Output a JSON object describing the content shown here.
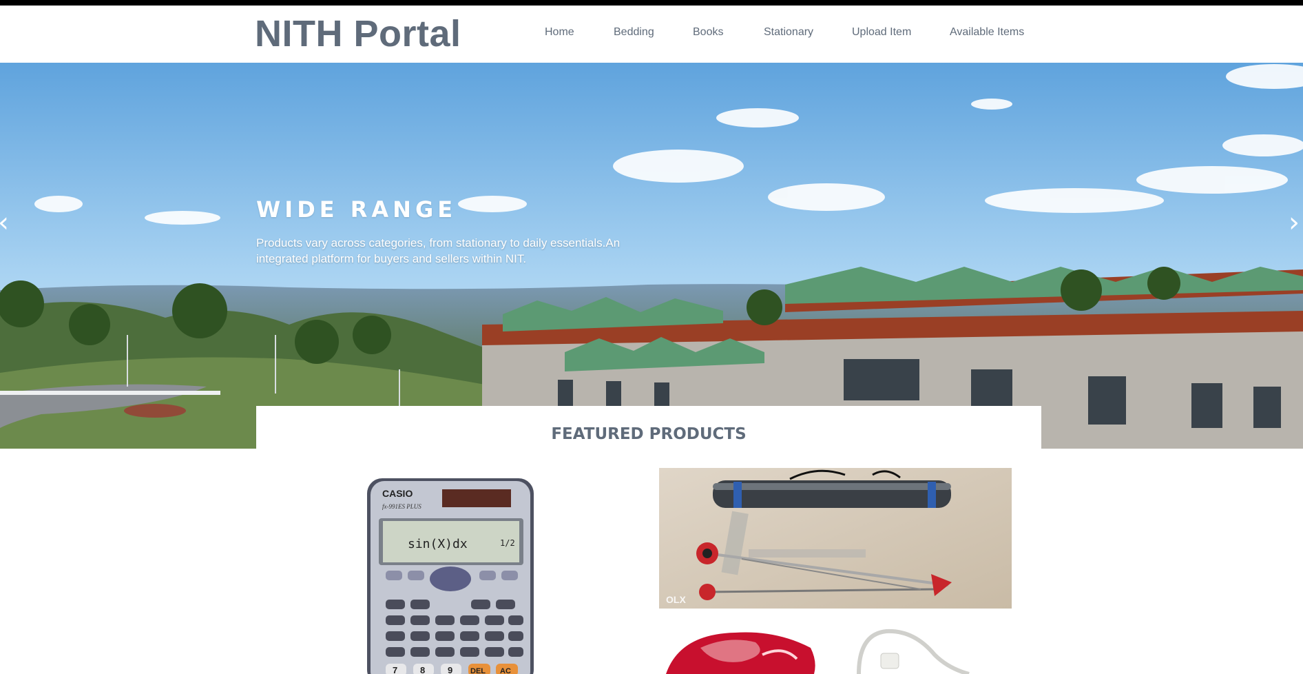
{
  "header": {
    "brand": "NITH Portal",
    "nav": [
      "Home",
      "Bedding",
      "Books",
      "Stationary",
      "Upload Item",
      "Available Items"
    ]
  },
  "hero": {
    "title": "WIDE RANGE",
    "text": "Products vary across categories, from stationary to daily essentials.An integrated platform for buyers and sellers within NIT.",
    "prev_icon": "chevron-left-icon",
    "next_icon": "chevron-right-icon"
  },
  "featured": {
    "title": "FEATURED PRODUCTS"
  },
  "products": {
    "calculator": {
      "brand": "CASIO",
      "model": "fx-991ES PLUS",
      "display": "sin(X)dx",
      "fraction": "1/2",
      "keys": [
        "7",
        "8",
        "9",
        "DEL",
        "AC"
      ]
    },
    "drawing_kit": {
      "watermark": "OLX"
    }
  },
  "colors": {
    "brand_text": "#5f6b7a",
    "sky": "#8ec3ec",
    "roof": "#5c9a73",
    "wall": "#b04a2c"
  }
}
